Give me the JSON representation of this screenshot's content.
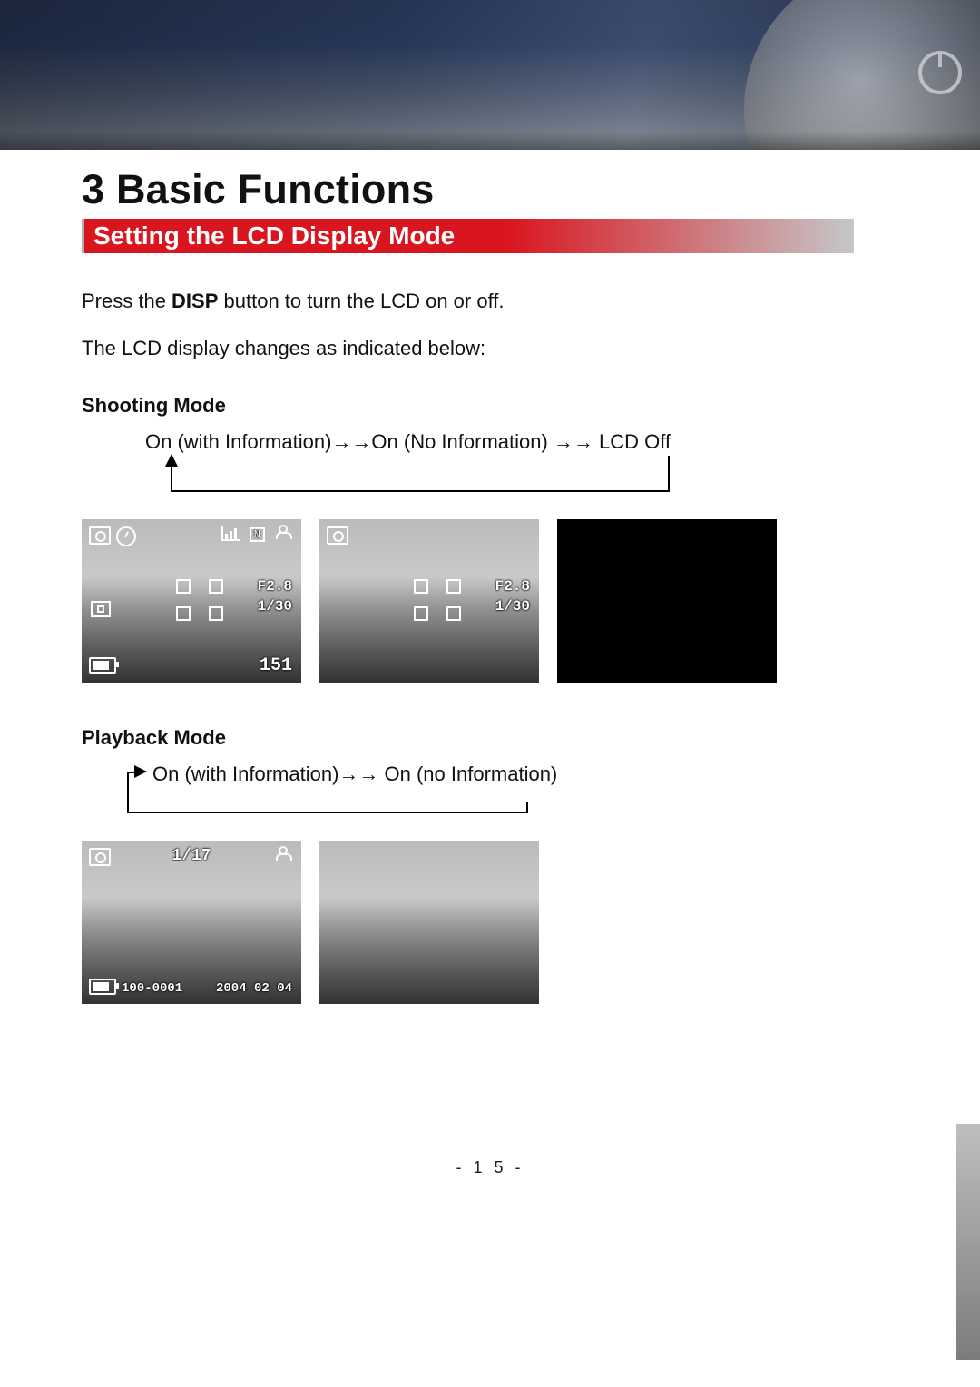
{
  "chapter_number": "3",
  "chapter_title": "Basic Functions",
  "section_title": "Setting the LCD Display Mode",
  "intro_before_bold": "Press the ",
  "intro_bold": "DISP",
  "intro_after_bold": " button to turn the LCD on or off.",
  "intro_line2": "The LCD display changes as indicated below:",
  "shooting": {
    "heading": "Shooting Mode",
    "flow_text": "On (with Information)→→On (No Information) →→ LCD Off",
    "lcd_info": {
      "aperture": "F2.8",
      "shutter": "1/30",
      "shots_remaining": "151",
      "quality_letter": "N"
    }
  },
  "playback": {
    "heading": "Playback Mode",
    "flow_text": "On (with Information)→→ On (no Information)",
    "lcd_info": {
      "counter": "1/17",
      "file_number": "100-0001",
      "date": "2004 02 04"
    }
  },
  "page_number": "- 1 5 -"
}
